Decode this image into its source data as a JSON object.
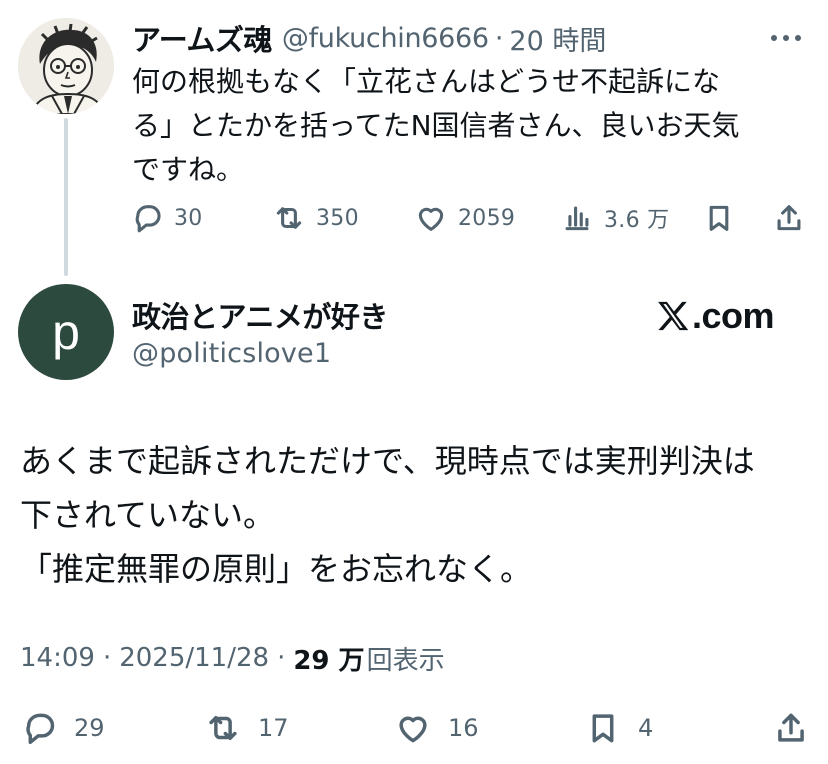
{
  "parent_tweet": {
    "display_name": "アームズ魂",
    "handle": "@fukuchin6666",
    "separator": "·",
    "time_ago": "20 時間",
    "text": "何の根拠もなく「立花さんはどうせ不起訴にな\nる」とたかを括ってたN国信者さん、良いお天気\nですね。",
    "counts": {
      "replies": "30",
      "retweets": "350",
      "likes": "2059",
      "views": "3.6 万"
    }
  },
  "main_tweet": {
    "avatar_letter": "p",
    "avatar_color": "#2d4a3e",
    "display_name": "政治とアニメが好き",
    "handle": "@politicslove1",
    "watermark": ".com",
    "text": "あくまで起訴されただけで、現時点では実刑判決は\n下されていない。\n「推定無罪の原則」をお忘れなく。",
    "time": "14:09",
    "separator": "·",
    "date": "2025/11/28",
    "views_count": "29 万",
    "views_label": "回表示",
    "counts": {
      "replies": "29",
      "retweets": "17",
      "likes": "16",
      "bookmarks": "4"
    }
  },
  "icons": [
    "more-icon",
    "reply-icon",
    "retweet-icon",
    "like-icon",
    "views-icon",
    "bookmark-icon",
    "share-icon",
    "x-logo-icon"
  ],
  "colors": {
    "secondary_text": "#536471",
    "primary_text": "#0f1419",
    "thread_line": "#cfd9de"
  }
}
